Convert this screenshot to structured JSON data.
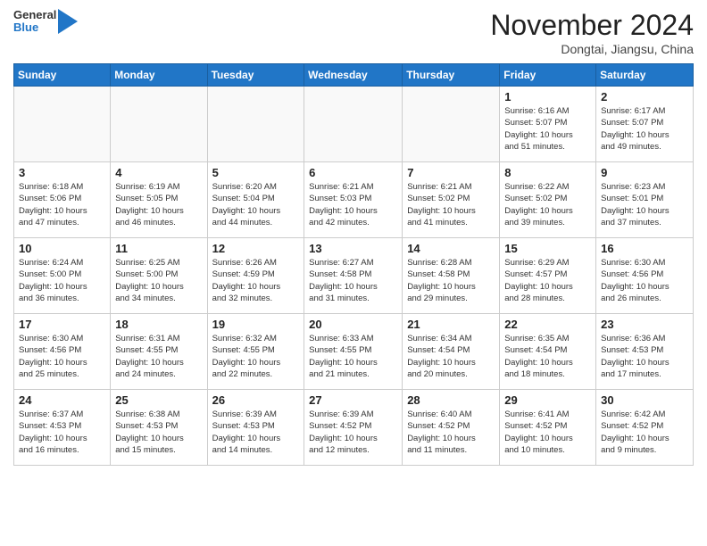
{
  "header": {
    "logo_general": "General",
    "logo_blue": "Blue",
    "month_title": "November 2024",
    "location": "Dongtai, Jiangsu, China"
  },
  "days_of_week": [
    "Sunday",
    "Monday",
    "Tuesday",
    "Wednesday",
    "Thursday",
    "Friday",
    "Saturday"
  ],
  "weeks": [
    [
      {
        "day": "",
        "info": ""
      },
      {
        "day": "",
        "info": ""
      },
      {
        "day": "",
        "info": ""
      },
      {
        "day": "",
        "info": ""
      },
      {
        "day": "",
        "info": ""
      },
      {
        "day": "1",
        "info": "Sunrise: 6:16 AM\nSunset: 5:07 PM\nDaylight: 10 hours\nand 51 minutes."
      },
      {
        "day": "2",
        "info": "Sunrise: 6:17 AM\nSunset: 5:07 PM\nDaylight: 10 hours\nand 49 minutes."
      }
    ],
    [
      {
        "day": "3",
        "info": "Sunrise: 6:18 AM\nSunset: 5:06 PM\nDaylight: 10 hours\nand 47 minutes."
      },
      {
        "day": "4",
        "info": "Sunrise: 6:19 AM\nSunset: 5:05 PM\nDaylight: 10 hours\nand 46 minutes."
      },
      {
        "day": "5",
        "info": "Sunrise: 6:20 AM\nSunset: 5:04 PM\nDaylight: 10 hours\nand 44 minutes."
      },
      {
        "day": "6",
        "info": "Sunrise: 6:21 AM\nSunset: 5:03 PM\nDaylight: 10 hours\nand 42 minutes."
      },
      {
        "day": "7",
        "info": "Sunrise: 6:21 AM\nSunset: 5:02 PM\nDaylight: 10 hours\nand 41 minutes."
      },
      {
        "day": "8",
        "info": "Sunrise: 6:22 AM\nSunset: 5:02 PM\nDaylight: 10 hours\nand 39 minutes."
      },
      {
        "day": "9",
        "info": "Sunrise: 6:23 AM\nSunset: 5:01 PM\nDaylight: 10 hours\nand 37 minutes."
      }
    ],
    [
      {
        "day": "10",
        "info": "Sunrise: 6:24 AM\nSunset: 5:00 PM\nDaylight: 10 hours\nand 36 minutes."
      },
      {
        "day": "11",
        "info": "Sunrise: 6:25 AM\nSunset: 5:00 PM\nDaylight: 10 hours\nand 34 minutes."
      },
      {
        "day": "12",
        "info": "Sunrise: 6:26 AM\nSunset: 4:59 PM\nDaylight: 10 hours\nand 32 minutes."
      },
      {
        "day": "13",
        "info": "Sunrise: 6:27 AM\nSunset: 4:58 PM\nDaylight: 10 hours\nand 31 minutes."
      },
      {
        "day": "14",
        "info": "Sunrise: 6:28 AM\nSunset: 4:58 PM\nDaylight: 10 hours\nand 29 minutes."
      },
      {
        "day": "15",
        "info": "Sunrise: 6:29 AM\nSunset: 4:57 PM\nDaylight: 10 hours\nand 28 minutes."
      },
      {
        "day": "16",
        "info": "Sunrise: 6:30 AM\nSunset: 4:56 PM\nDaylight: 10 hours\nand 26 minutes."
      }
    ],
    [
      {
        "day": "17",
        "info": "Sunrise: 6:30 AM\nSunset: 4:56 PM\nDaylight: 10 hours\nand 25 minutes."
      },
      {
        "day": "18",
        "info": "Sunrise: 6:31 AM\nSunset: 4:55 PM\nDaylight: 10 hours\nand 24 minutes."
      },
      {
        "day": "19",
        "info": "Sunrise: 6:32 AM\nSunset: 4:55 PM\nDaylight: 10 hours\nand 22 minutes."
      },
      {
        "day": "20",
        "info": "Sunrise: 6:33 AM\nSunset: 4:55 PM\nDaylight: 10 hours\nand 21 minutes."
      },
      {
        "day": "21",
        "info": "Sunrise: 6:34 AM\nSunset: 4:54 PM\nDaylight: 10 hours\nand 20 minutes."
      },
      {
        "day": "22",
        "info": "Sunrise: 6:35 AM\nSunset: 4:54 PM\nDaylight: 10 hours\nand 18 minutes."
      },
      {
        "day": "23",
        "info": "Sunrise: 6:36 AM\nSunset: 4:53 PM\nDaylight: 10 hours\nand 17 minutes."
      }
    ],
    [
      {
        "day": "24",
        "info": "Sunrise: 6:37 AM\nSunset: 4:53 PM\nDaylight: 10 hours\nand 16 minutes."
      },
      {
        "day": "25",
        "info": "Sunrise: 6:38 AM\nSunset: 4:53 PM\nDaylight: 10 hours\nand 15 minutes."
      },
      {
        "day": "26",
        "info": "Sunrise: 6:39 AM\nSunset: 4:53 PM\nDaylight: 10 hours\nand 14 minutes."
      },
      {
        "day": "27",
        "info": "Sunrise: 6:39 AM\nSunset: 4:52 PM\nDaylight: 10 hours\nand 12 minutes."
      },
      {
        "day": "28",
        "info": "Sunrise: 6:40 AM\nSunset: 4:52 PM\nDaylight: 10 hours\nand 11 minutes."
      },
      {
        "day": "29",
        "info": "Sunrise: 6:41 AM\nSunset: 4:52 PM\nDaylight: 10 hours\nand 10 minutes."
      },
      {
        "day": "30",
        "info": "Sunrise: 6:42 AM\nSunset: 4:52 PM\nDaylight: 10 hours\nand 9 minutes."
      }
    ]
  ]
}
